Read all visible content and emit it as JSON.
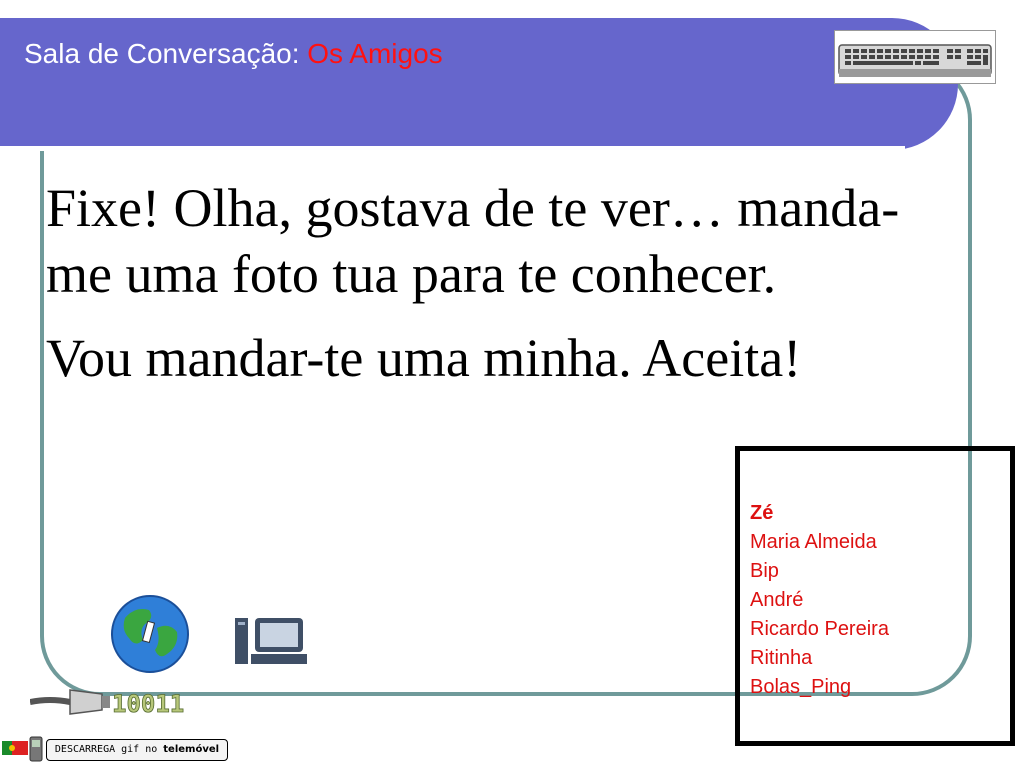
{
  "header": {
    "title_prefix": "Sala de Conversação: ",
    "room_name": "Os Amigos",
    "title_color": "#ffffff",
    "room_color": "#ff1111",
    "bg_color": "#6666cc"
  },
  "message": {
    "paragraph1": "Fixe! Olha, gostava de te ver… manda-me uma foto tua para te conhecer.",
    "paragraph2": "Vou mandar-te uma minha. Aceita!"
  },
  "users": {
    "items": [
      {
        "name": "Zé",
        "bold": true
      },
      {
        "name": "Maria Almeida",
        "bold": false
      },
      {
        "name": "Bip",
        "bold": false
      },
      {
        "name": "André",
        "bold": false
      },
      {
        "name": "Ricardo Pereira",
        "bold": false
      },
      {
        "name": "Ritinha",
        "bold": false
      },
      {
        "name": "Bolas_Ping",
        "bold": false
      }
    ],
    "color": "#dd1111"
  },
  "icons": {
    "keyboard": "keyboard-icon",
    "globe": "globe-icon",
    "computer": "computer-icon",
    "cable": "network-cable-icon",
    "binary_text": "10011",
    "flag": "portugal-flag-icon",
    "phone": "mobile-phone-icon"
  },
  "download": {
    "prefix": "DESCARREGA gif no ",
    "bold_word": "telemóvel"
  }
}
